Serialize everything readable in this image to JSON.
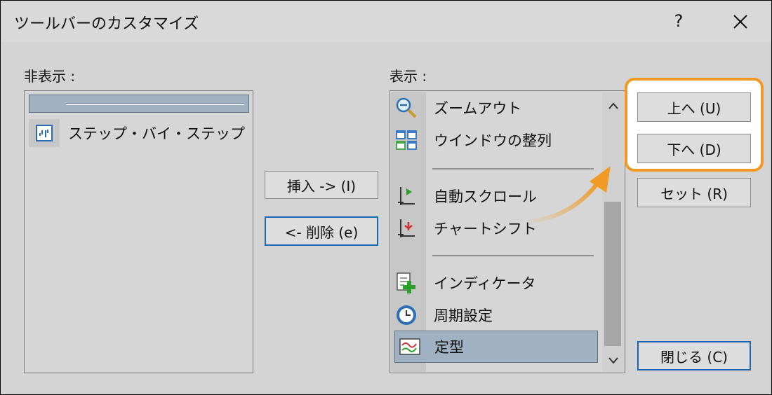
{
  "window": {
    "title": "ツールバーのカスタマイズ",
    "help_label": "?"
  },
  "hidden": {
    "label": "非表示 :",
    "items": [
      {
        "label": "ステップ・バイ・ステップ",
        "icon": "step-by-step-icon"
      }
    ]
  },
  "shown": {
    "label": "表示 :",
    "items": [
      {
        "label": "ズームアウト",
        "icon": "zoom-out-icon"
      },
      {
        "label": "ウインドウの整列",
        "icon": "window-tile-icon"
      },
      {
        "label": "自動スクロール",
        "icon": "auto-scroll-icon"
      },
      {
        "label": "チャートシフト",
        "icon": "chart-shift-icon"
      },
      {
        "label": "インディケータ",
        "icon": "add-indicator-icon"
      },
      {
        "label": "周期設定",
        "icon": "period-clock-icon"
      },
      {
        "label": "定型",
        "icon": "template-icon"
      }
    ],
    "selected": "定型"
  },
  "buttons": {
    "insert": "挿入 -> (I)",
    "remove": "<- 削除 (e)",
    "up": "上へ (U)",
    "down": "下へ (D)",
    "reset": "セット (R)",
    "close": "閉じる (C)"
  },
  "colors": {
    "highlight": "#f19a23",
    "selection": "#9fb1c2",
    "focus": "#1e64b4"
  }
}
